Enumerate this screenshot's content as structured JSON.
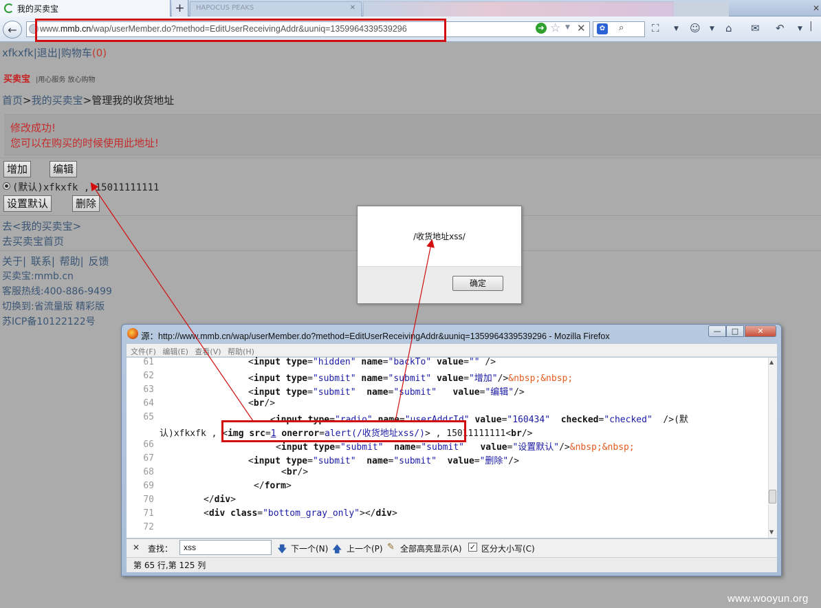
{
  "browser": {
    "active_tab_title": "我的买卖宝",
    "new_tab_symbol": "+",
    "ghost_tab_title": "HAPOCUS PEAKS",
    "url_prefix": "www.",
    "url_domain": "mmb.cn",
    "url_rest": "/wap/userMember.do?method=EditUserReceivingAddr&uuniq=1359964339539296",
    "toolbar_separator": "|"
  },
  "page": {
    "top_links": {
      "user": "xfkxfk",
      "logout": "退出",
      "cart": "购物车",
      "cart_count": "(0)"
    },
    "logo": "买卖宝",
    "slogan": "|用心服务 放心购物",
    "breadcrumb": {
      "home": "首页",
      "my": "我的买卖宝",
      "current": "管理我的收货地址"
    },
    "success": {
      "line1": "修改成功!",
      "line2": "您可以在购买的时候使用此地址!"
    },
    "buttons": {
      "add": "增加",
      "edit": "编辑",
      "set_default": "设置默认",
      "delete": "删除"
    },
    "address_entry": "(默认)xfkxfk , 15011111111",
    "links": {
      "go_my": "去<我的买卖宝>",
      "go_home": "去买卖宝首页"
    },
    "footer": {
      "links": "关于| 联系| 帮助| 反馈",
      "brand": "买卖宝:mmb.cn",
      "hotline": "客服热线:400-886-9499",
      "switch": "切换到:省流量版 精彩版",
      "icp": "苏ICP备10122122号"
    }
  },
  "alert": {
    "message": "/收货地址xss/",
    "ok_label": "确定"
  },
  "source_window": {
    "title": "源：http://www.mmb.cn/wap/userMember.do?method=EditUserReceivingAddr&uuniq=1359964339539296 - Mozilla Firefox",
    "window_controls": {
      "minimize": "—",
      "maximize": "□",
      "close": "✕"
    },
    "menu": "文件(F) 编辑(E) 查看(V) 帮助(H)",
    "line_numbers": [
      "61",
      "62",
      "63",
      "64",
      "65",
      "",
      "66",
      "67",
      "68",
      "69",
      "70",
      "71",
      "72"
    ],
    "find": {
      "close": "✕",
      "label": "查找：",
      "query": "xss",
      "next": "下一个(N)",
      "prev": "上一个(P)",
      "highlight_all": "全部高亮显示(A)",
      "case_sensitive": "区分大小写(C)",
      "case_checked": "✓"
    },
    "status": "第 65 行,第 125 列"
  },
  "watermark": "www.wooyun.org",
  "colors": {
    "highlight_red": "#d10d0d",
    "link_blue": "#3b5675",
    "success_red": "#c42b2b"
  }
}
